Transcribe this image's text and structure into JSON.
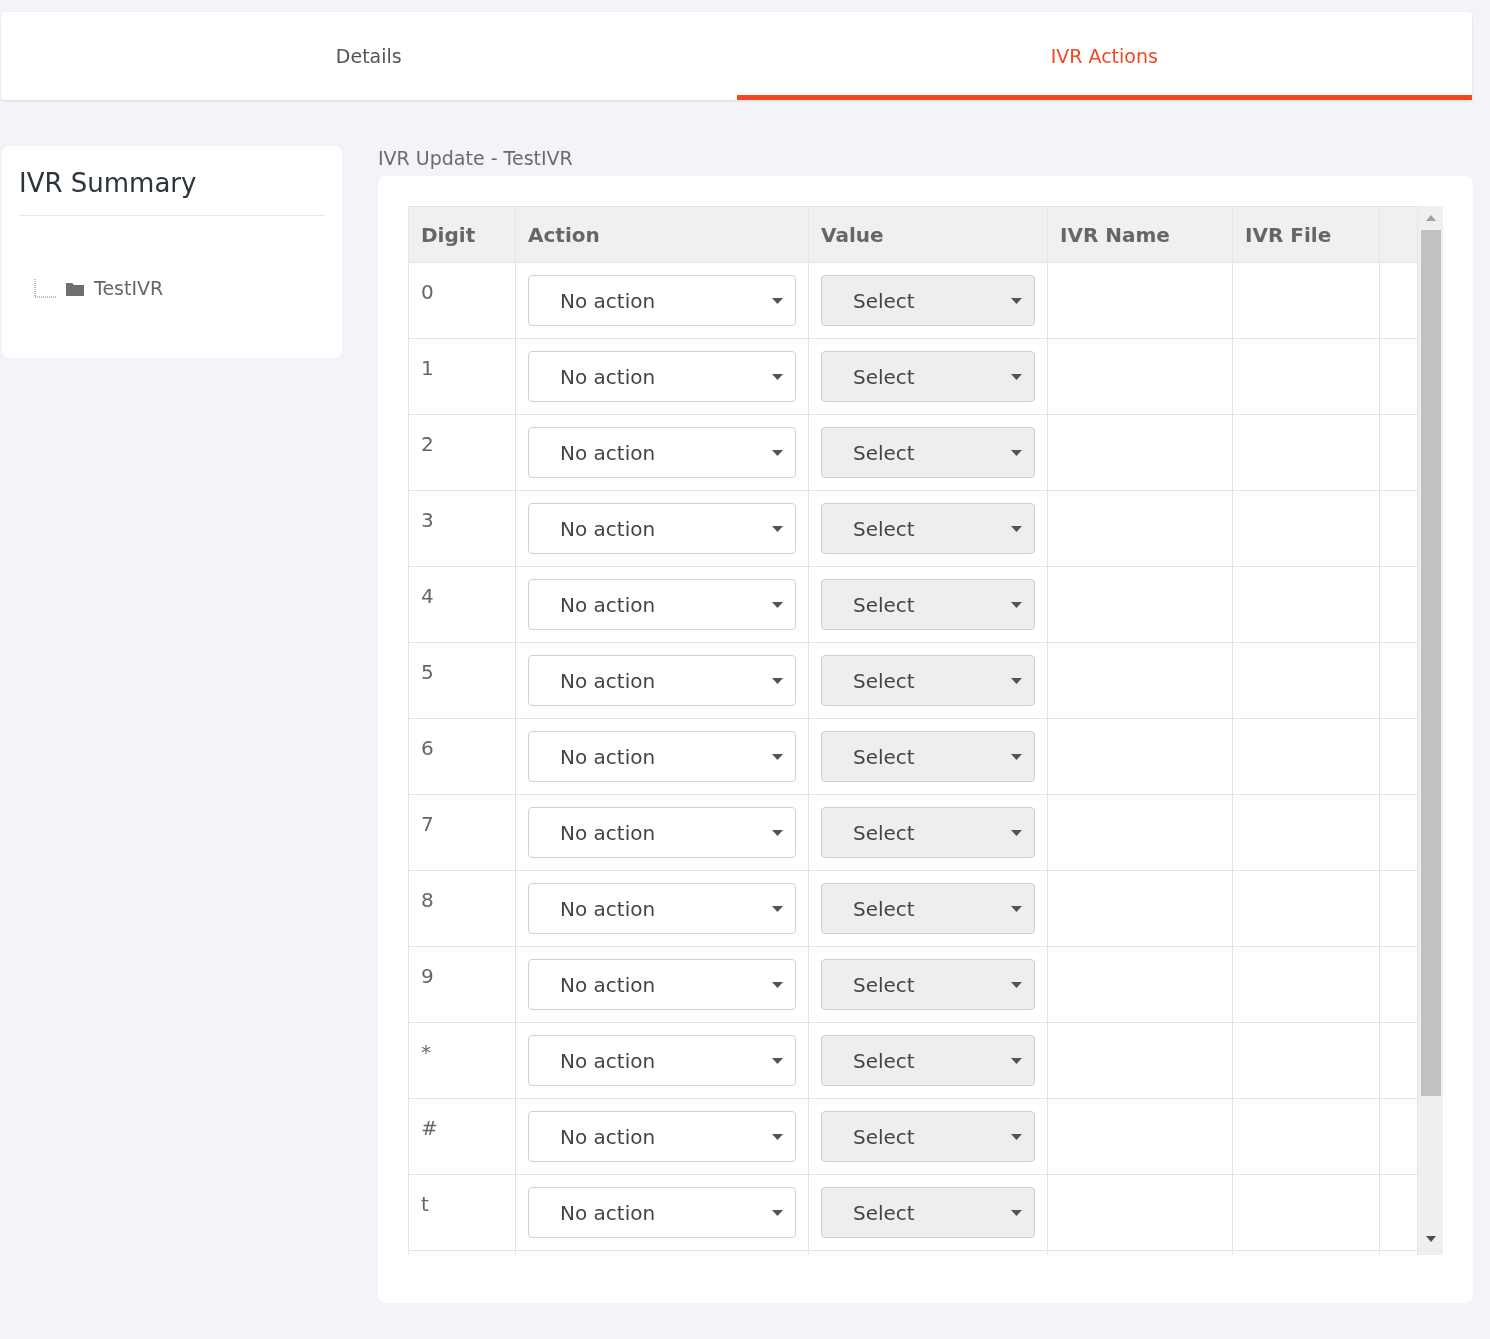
{
  "tabs": [
    {
      "label": "Details",
      "selected": false
    },
    {
      "label": "IVR Actions",
      "selected": true
    }
  ],
  "summary": {
    "title": "IVR Summary",
    "tree": [
      {
        "label": "TestIVR"
      }
    ]
  },
  "panel_title": "IVR Update - TestIVR",
  "table": {
    "columns": [
      "Digit",
      "Action",
      "Value",
      "IVR Name",
      "IVR File"
    ],
    "rows": [
      {
        "digit": "0",
        "action": "No action",
        "value": "Select",
        "value_disabled": true
      },
      {
        "digit": "1",
        "action": "No action",
        "value": "Select",
        "value_disabled": true
      },
      {
        "digit": "2",
        "action": "No action",
        "value": "Select",
        "value_disabled": true
      },
      {
        "digit": "3",
        "action": "No action",
        "value": "Select",
        "value_disabled": true
      },
      {
        "digit": "4",
        "action": "No action",
        "value": "Select",
        "value_disabled": true
      },
      {
        "digit": "5",
        "action": "No action",
        "value": "Select",
        "value_disabled": true
      },
      {
        "digit": "6",
        "action": "No action",
        "value": "Select",
        "value_disabled": true
      },
      {
        "digit": "7",
        "action": "No action",
        "value": "Select",
        "value_disabled": true
      },
      {
        "digit": "8",
        "action": "No action",
        "value": "Select",
        "value_disabled": true
      },
      {
        "digit": "9",
        "action": "No action",
        "value": "Select",
        "value_disabled": true
      },
      {
        "digit": "*",
        "action": "No action",
        "value": "Select",
        "value_disabled": true
      },
      {
        "digit": "#",
        "action": "No action",
        "value": "Select",
        "value_disabled": true
      },
      {
        "digit": "t",
        "action": "No action",
        "value": "Select",
        "value_disabled": true
      }
    ]
  }
}
